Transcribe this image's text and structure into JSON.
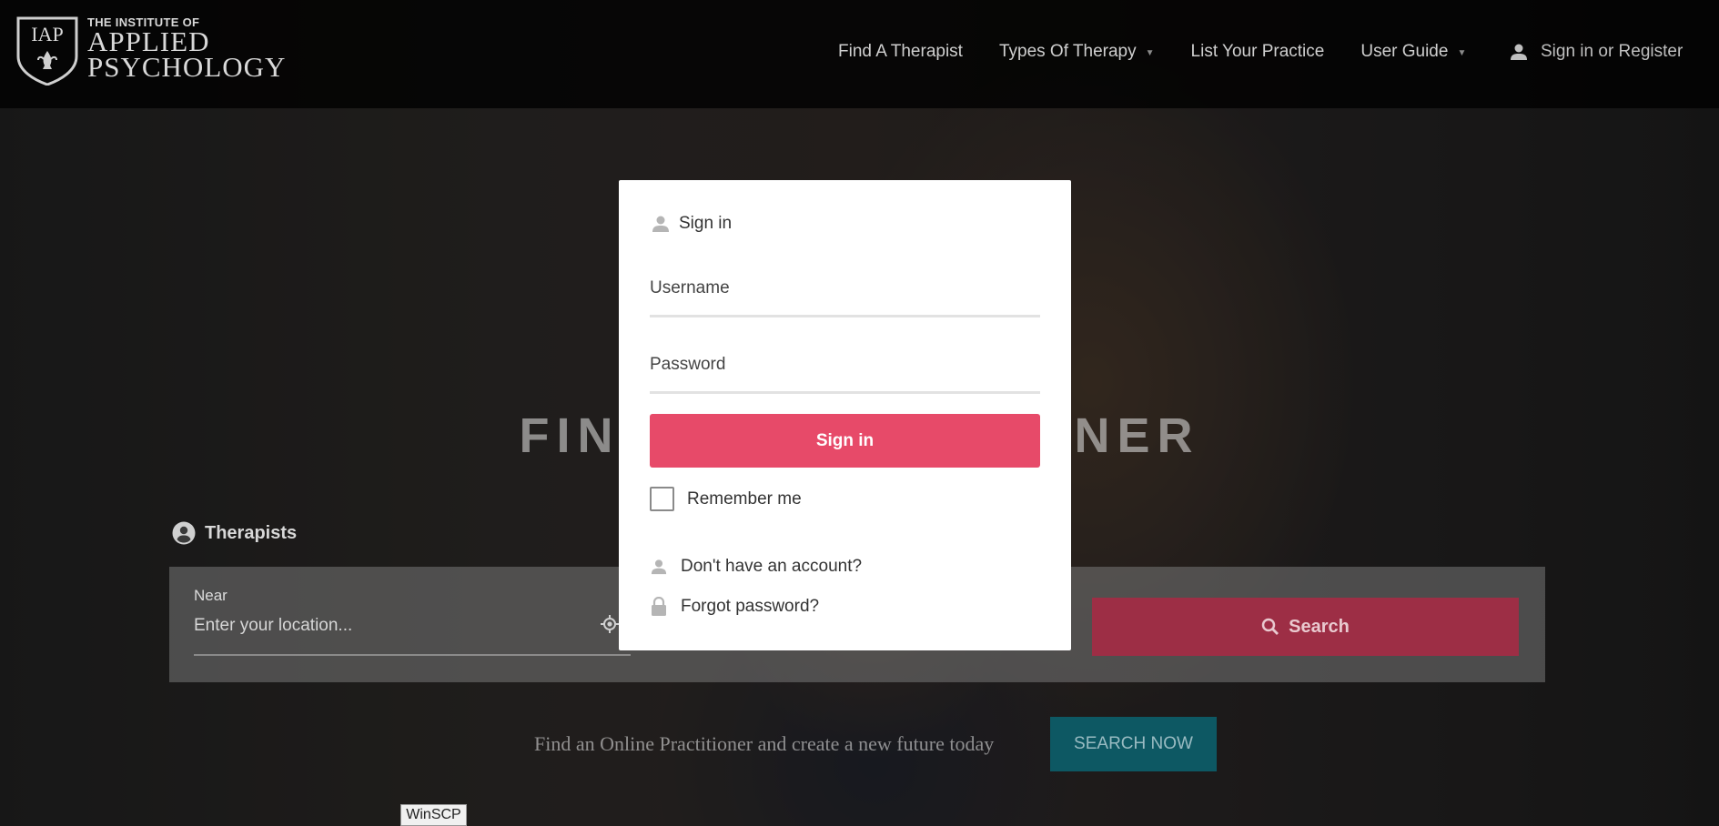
{
  "header": {
    "logo": {
      "monogram": "IAP",
      "small": "THE INSTITUTE OF",
      "line1": "APPLIED",
      "line2": "PSYCHOLOGY"
    },
    "nav": [
      {
        "label": "Find A Therapist",
        "has_dropdown": false
      },
      {
        "label": "Types Of Therapy",
        "has_dropdown": true
      },
      {
        "label": "List Your Practice",
        "has_dropdown": false
      },
      {
        "label": "User Guide",
        "has_dropdown": true
      }
    ],
    "signin_label": "Sign in or Register",
    "signin_icon": "user-icon"
  },
  "hero": {
    "title": "FIND A PRACTITIONER"
  },
  "search": {
    "tab_label": "Therapists",
    "tab_icon": "account-circle-icon",
    "near_label": "Near",
    "near_placeholder": "Enter your location...",
    "near_value": "",
    "button_label": "Search",
    "button_icon": "search-icon"
  },
  "tagline": {
    "text": "Find an Online Practitioner and create a new future today",
    "button_label": "SEARCH NOW"
  },
  "taskbar_tooltip": "WinSCP",
  "modal": {
    "title": "Sign in",
    "title_icon": "user-icon",
    "username_label": "Username",
    "username_value": "",
    "password_label": "Password",
    "password_value": "",
    "submit_label": "Sign in",
    "remember_label": "Remember me",
    "remember_checked": false,
    "register_link": "Don't have an account?",
    "register_icon": "user-icon",
    "forgot_link": "Forgot password?",
    "forgot_icon": "lock-icon"
  },
  "colors": {
    "accent": "#e74a69",
    "search_button": "#9d2e45",
    "search_now": "#0d5863"
  }
}
